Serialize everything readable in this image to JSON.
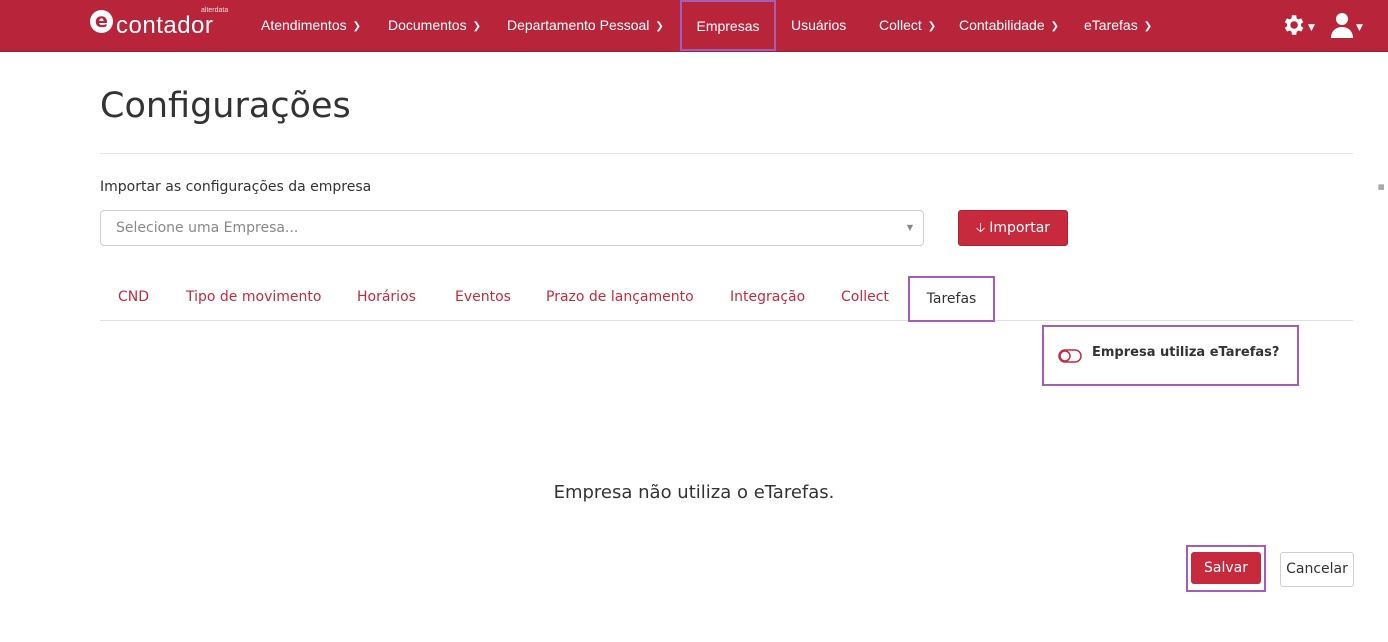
{
  "header": {
    "logo_small": "alterdata",
    "logo_text": "contador",
    "logo_letter": "e",
    "nav": [
      {
        "label": "Atendimentos",
        "dropdown": true
      },
      {
        "label": "Documentos",
        "dropdown": true
      },
      {
        "label": "Departamento Pessoal",
        "dropdown": true
      },
      {
        "label": "Empresas",
        "dropdown": false,
        "active": true
      },
      {
        "label": "Usuários",
        "dropdown": false
      },
      {
        "label": "Collect",
        "dropdown": true
      },
      {
        "label": "Contabilidade",
        "dropdown": true
      },
      {
        "label": "eTarefas",
        "dropdown": true
      }
    ],
    "settings_icon": "gear-icon",
    "user_icon": "user-icon"
  },
  "page": {
    "title": "Configurações",
    "import_label": "Importar as configurações da empresa",
    "select_placeholder": "Selecione uma Empresa...",
    "import_button": "Importar"
  },
  "tabs": [
    {
      "label": "CND"
    },
    {
      "label": "Tipo de movimento"
    },
    {
      "label": "Horários"
    },
    {
      "label": "Eventos"
    },
    {
      "label": "Prazo de lançamento"
    },
    {
      "label": "Integração"
    },
    {
      "label": "Collect"
    },
    {
      "label": "Tarefas",
      "active": true
    }
  ],
  "etarefas": {
    "toggle_label": "Empresa utiliza eTarefas?",
    "toggle_on": false,
    "empty_message": "Empresa não utiliza o eTarefas."
  },
  "actions": {
    "save": "Salvar",
    "cancel": "Cancelar"
  },
  "colors": {
    "brand": "#b8253a",
    "accent_button": "#c72a3d",
    "highlight": "#a35fb5"
  }
}
